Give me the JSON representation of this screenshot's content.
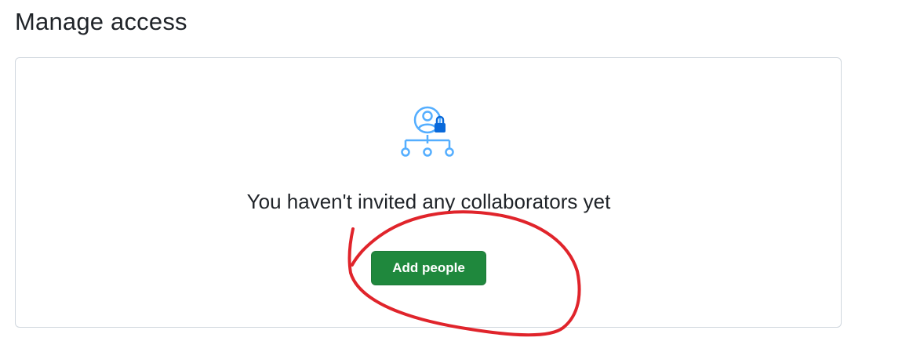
{
  "page": {
    "title": "Manage access"
  },
  "empty_state": {
    "icon": "person-lock-network-icon",
    "message": "You haven't invited any collaborators yet",
    "add_button_label": "Add people"
  },
  "colors": {
    "button_green": "#1f883d",
    "icon_blue": "#54aeff",
    "annotation_red": "#e0242b"
  }
}
